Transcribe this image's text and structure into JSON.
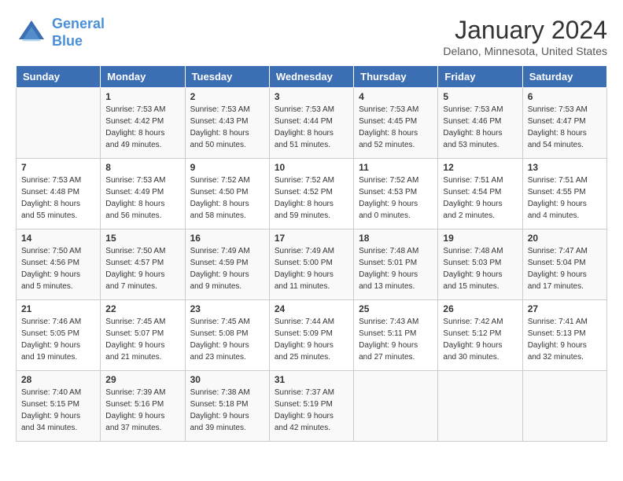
{
  "logo": {
    "line1": "General",
    "line2": "Blue"
  },
  "title": "January 2024",
  "subtitle": "Delano, Minnesota, United States",
  "headers": [
    "Sunday",
    "Monday",
    "Tuesday",
    "Wednesday",
    "Thursday",
    "Friday",
    "Saturday"
  ],
  "weeks": [
    [
      {
        "day": "",
        "sunrise": "",
        "sunset": "",
        "daylight": ""
      },
      {
        "day": "1",
        "sunrise": "Sunrise: 7:53 AM",
        "sunset": "Sunset: 4:42 PM",
        "daylight": "Daylight: 8 hours and 49 minutes."
      },
      {
        "day": "2",
        "sunrise": "Sunrise: 7:53 AM",
        "sunset": "Sunset: 4:43 PM",
        "daylight": "Daylight: 8 hours and 50 minutes."
      },
      {
        "day": "3",
        "sunrise": "Sunrise: 7:53 AM",
        "sunset": "Sunset: 4:44 PM",
        "daylight": "Daylight: 8 hours and 51 minutes."
      },
      {
        "day": "4",
        "sunrise": "Sunrise: 7:53 AM",
        "sunset": "Sunset: 4:45 PM",
        "daylight": "Daylight: 8 hours and 52 minutes."
      },
      {
        "day": "5",
        "sunrise": "Sunrise: 7:53 AM",
        "sunset": "Sunset: 4:46 PM",
        "daylight": "Daylight: 8 hours and 53 minutes."
      },
      {
        "day": "6",
        "sunrise": "Sunrise: 7:53 AM",
        "sunset": "Sunset: 4:47 PM",
        "daylight": "Daylight: 8 hours and 54 minutes."
      }
    ],
    [
      {
        "day": "7",
        "sunrise": "Sunrise: 7:53 AM",
        "sunset": "Sunset: 4:48 PM",
        "daylight": "Daylight: 8 hours and 55 minutes."
      },
      {
        "day": "8",
        "sunrise": "Sunrise: 7:53 AM",
        "sunset": "Sunset: 4:49 PM",
        "daylight": "Daylight: 8 hours and 56 minutes."
      },
      {
        "day": "9",
        "sunrise": "Sunrise: 7:52 AM",
        "sunset": "Sunset: 4:50 PM",
        "daylight": "Daylight: 8 hours and 58 minutes."
      },
      {
        "day": "10",
        "sunrise": "Sunrise: 7:52 AM",
        "sunset": "Sunset: 4:52 PM",
        "daylight": "Daylight: 8 hours and 59 minutes."
      },
      {
        "day": "11",
        "sunrise": "Sunrise: 7:52 AM",
        "sunset": "Sunset: 4:53 PM",
        "daylight": "Daylight: 9 hours and 0 minutes."
      },
      {
        "day": "12",
        "sunrise": "Sunrise: 7:51 AM",
        "sunset": "Sunset: 4:54 PM",
        "daylight": "Daylight: 9 hours and 2 minutes."
      },
      {
        "day": "13",
        "sunrise": "Sunrise: 7:51 AM",
        "sunset": "Sunset: 4:55 PM",
        "daylight": "Daylight: 9 hours and 4 minutes."
      }
    ],
    [
      {
        "day": "14",
        "sunrise": "Sunrise: 7:50 AM",
        "sunset": "Sunset: 4:56 PM",
        "daylight": "Daylight: 9 hours and 5 minutes."
      },
      {
        "day": "15",
        "sunrise": "Sunrise: 7:50 AM",
        "sunset": "Sunset: 4:57 PM",
        "daylight": "Daylight: 9 hours and 7 minutes."
      },
      {
        "day": "16",
        "sunrise": "Sunrise: 7:49 AM",
        "sunset": "Sunset: 4:59 PM",
        "daylight": "Daylight: 9 hours and 9 minutes."
      },
      {
        "day": "17",
        "sunrise": "Sunrise: 7:49 AM",
        "sunset": "Sunset: 5:00 PM",
        "daylight": "Daylight: 9 hours and 11 minutes."
      },
      {
        "day": "18",
        "sunrise": "Sunrise: 7:48 AM",
        "sunset": "Sunset: 5:01 PM",
        "daylight": "Daylight: 9 hours and 13 minutes."
      },
      {
        "day": "19",
        "sunrise": "Sunrise: 7:48 AM",
        "sunset": "Sunset: 5:03 PM",
        "daylight": "Daylight: 9 hours and 15 minutes."
      },
      {
        "day": "20",
        "sunrise": "Sunrise: 7:47 AM",
        "sunset": "Sunset: 5:04 PM",
        "daylight": "Daylight: 9 hours and 17 minutes."
      }
    ],
    [
      {
        "day": "21",
        "sunrise": "Sunrise: 7:46 AM",
        "sunset": "Sunset: 5:05 PM",
        "daylight": "Daylight: 9 hours and 19 minutes."
      },
      {
        "day": "22",
        "sunrise": "Sunrise: 7:45 AM",
        "sunset": "Sunset: 5:07 PM",
        "daylight": "Daylight: 9 hours and 21 minutes."
      },
      {
        "day": "23",
        "sunrise": "Sunrise: 7:45 AM",
        "sunset": "Sunset: 5:08 PM",
        "daylight": "Daylight: 9 hours and 23 minutes."
      },
      {
        "day": "24",
        "sunrise": "Sunrise: 7:44 AM",
        "sunset": "Sunset: 5:09 PM",
        "daylight": "Daylight: 9 hours and 25 minutes."
      },
      {
        "day": "25",
        "sunrise": "Sunrise: 7:43 AM",
        "sunset": "Sunset: 5:11 PM",
        "daylight": "Daylight: 9 hours and 27 minutes."
      },
      {
        "day": "26",
        "sunrise": "Sunrise: 7:42 AM",
        "sunset": "Sunset: 5:12 PM",
        "daylight": "Daylight: 9 hours and 30 minutes."
      },
      {
        "day": "27",
        "sunrise": "Sunrise: 7:41 AM",
        "sunset": "Sunset: 5:13 PM",
        "daylight": "Daylight: 9 hours and 32 minutes."
      }
    ],
    [
      {
        "day": "28",
        "sunrise": "Sunrise: 7:40 AM",
        "sunset": "Sunset: 5:15 PM",
        "daylight": "Daylight: 9 hours and 34 minutes."
      },
      {
        "day": "29",
        "sunrise": "Sunrise: 7:39 AM",
        "sunset": "Sunset: 5:16 PM",
        "daylight": "Daylight: 9 hours and 37 minutes."
      },
      {
        "day": "30",
        "sunrise": "Sunrise: 7:38 AM",
        "sunset": "Sunset: 5:18 PM",
        "daylight": "Daylight: 9 hours and 39 minutes."
      },
      {
        "day": "31",
        "sunrise": "Sunrise: 7:37 AM",
        "sunset": "Sunset: 5:19 PM",
        "daylight": "Daylight: 9 hours and 42 minutes."
      },
      {
        "day": "",
        "sunrise": "",
        "sunset": "",
        "daylight": ""
      },
      {
        "day": "",
        "sunrise": "",
        "sunset": "",
        "daylight": ""
      },
      {
        "day": "",
        "sunrise": "",
        "sunset": "",
        "daylight": ""
      }
    ]
  ]
}
